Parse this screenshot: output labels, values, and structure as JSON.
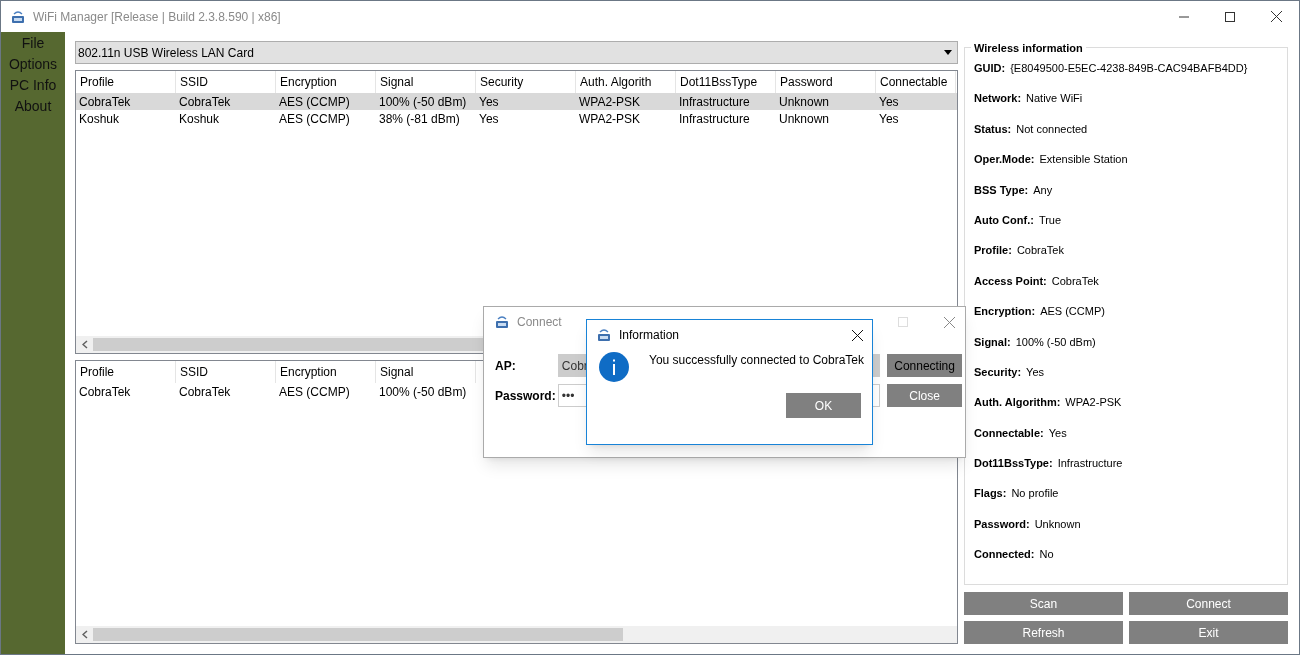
{
  "window": {
    "title": "WiFi Manager [Release | Build 2.3.8.590 | x86]"
  },
  "menu": [
    {
      "label": "File"
    },
    {
      "label": "Options"
    },
    {
      "label": "PC Info"
    },
    {
      "label": "About"
    }
  ],
  "adapter": {
    "value": "802.11n USB Wireless LAN Card"
  },
  "networks_table": {
    "columns": [
      "Profile",
      "SSID",
      "Encryption",
      "Signal",
      "Security",
      "Auth. Algorith",
      "Dot11BssType",
      "Password",
      "Connectable"
    ],
    "rows": [
      {
        "cells": [
          "CobraTek",
          "CobraTek",
          "AES (CCMP)",
          "100% (-50 dBm)",
          "Yes",
          "WPA2-PSK",
          "Infrastructure",
          "Unknown",
          "Yes"
        ],
        "selected": true
      },
      {
        "cells": [
          "Koshuk",
          "Koshuk",
          "AES (CCMP)",
          "38% (-81 dBm)",
          "Yes",
          "WPA2-PSK",
          "Infrastructure",
          "Unknown",
          "Yes"
        ],
        "selected": false
      }
    ]
  },
  "profiles_table": {
    "columns": [
      "Profile",
      "SSID",
      "Encryption",
      "Signal"
    ],
    "rows": [
      {
        "cells": [
          "CobraTek",
          "CobraTek",
          "AES (CCMP)",
          "100% (-50 dBm)"
        ],
        "selected": false
      }
    ]
  },
  "wireless_info": {
    "title": "Wireless information",
    "fields": [
      {
        "label": "GUID:",
        "value": "{E8049500-E5EC-4238-849B-CAC94BAFB4DD}"
      },
      {
        "label": "Network:",
        "value": "Native WiFi"
      },
      {
        "label": "Status:",
        "value": "Not connected"
      },
      {
        "label": "Oper.Mode:",
        "value": "Extensible Station"
      },
      {
        "label": "BSS Type:",
        "value": "Any"
      },
      {
        "label": "Auto Conf.:",
        "value": "True"
      },
      {
        "label": "Profile:",
        "value": "CobraTek"
      },
      {
        "label": "Access Point:",
        "value": "CobraTek"
      },
      {
        "label": "Encryption:",
        "value": "AES (CCMP)"
      },
      {
        "label": "Signal:",
        "value": "100% (-50 dBm)"
      },
      {
        "label": "Security:",
        "value": "Yes"
      },
      {
        "label": "Auth. Algorithm:",
        "value": "WPA2-PSK"
      },
      {
        "label": "Connectable:",
        "value": "Yes"
      },
      {
        "label": "Dot11BssType:",
        "value": "Infrastructure"
      },
      {
        "label": "Flags:",
        "value": "No profile"
      },
      {
        "label": "Password:",
        "value": "Unknown"
      },
      {
        "label": "Connected:",
        "value": "No"
      }
    ]
  },
  "buttons": [
    "Scan",
    "Connect",
    "Refresh",
    "Exit"
  ],
  "connect_dialog": {
    "title": "Connect",
    "ap_label": "AP:",
    "ap_value": "Cobr",
    "password_label": "Password:",
    "password_value": "•••",
    "buttons": [
      "Connecting",
      "Close"
    ]
  },
  "info_dialog": {
    "title": "Information",
    "message": "You successfully connected to CobraTek",
    "button": "OK"
  }
}
